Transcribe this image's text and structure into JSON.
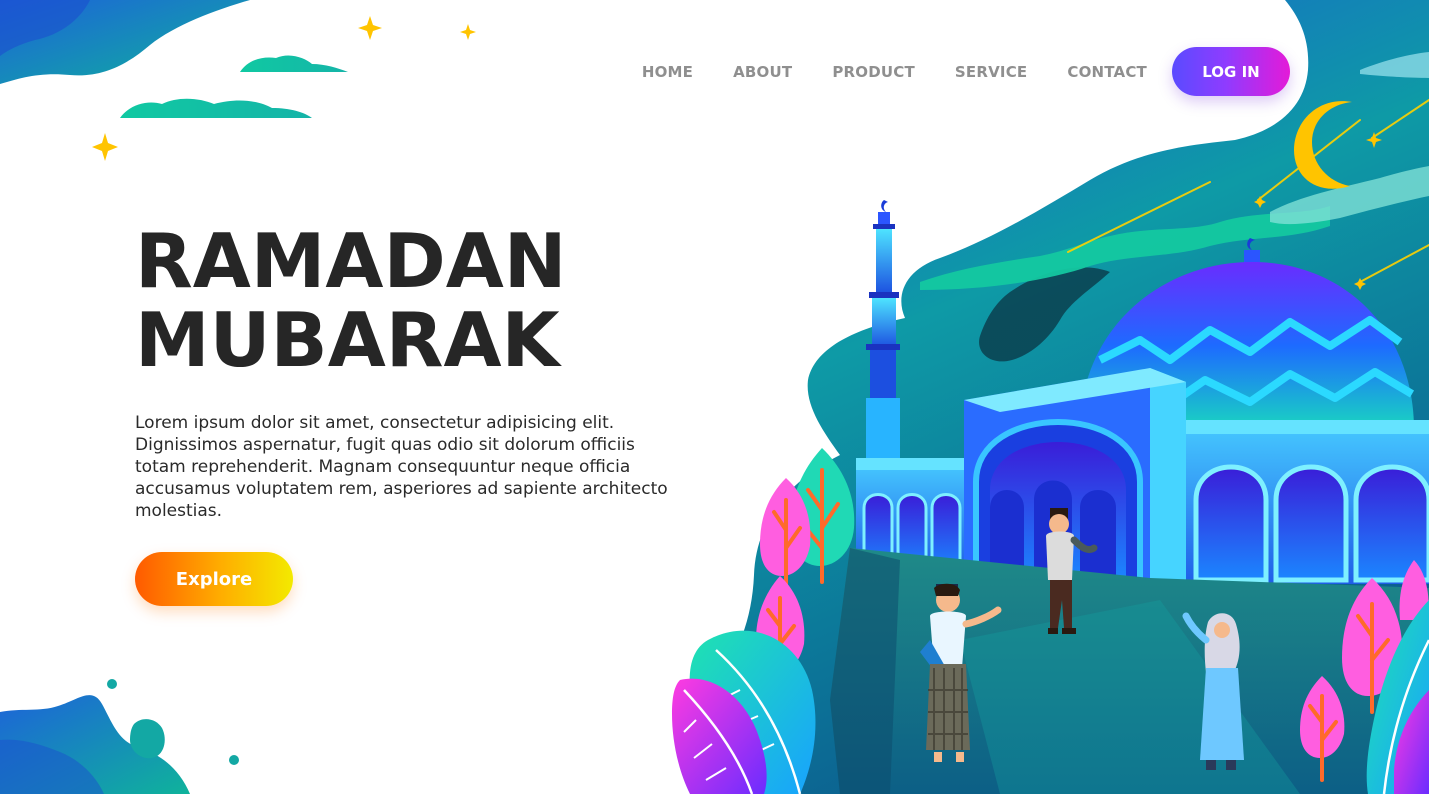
{
  "nav": {
    "items": [
      {
        "label": "HOME"
      },
      {
        "label": "ABOUT"
      },
      {
        "label": "PRODUCT"
      },
      {
        "label": "SERVICE"
      },
      {
        "label": "CONTACT"
      }
    ],
    "login_label": "LOG IN"
  },
  "hero": {
    "title_line1": "RAMADAN",
    "title_line2": "MUBARAK",
    "text": "Lorem ipsum dolor sit amet, consectetur adipisicing elit. Dignissimos aspernatur, fugit quas odio sit dolorum officiis totam reprehenderit. Magnam consequuntur neque officia accusamus voluptatem rem, asperiores ad sapiente architecto molestias.",
    "explore_label": "Explore"
  },
  "illustration": {
    "icons": [
      "star-icon",
      "crescent-moon-icon",
      "cloud-icon",
      "mosque-icon",
      "minaret-icon",
      "tree-icon",
      "leaf-icon",
      "person-icon"
    ]
  },
  "colors": {
    "teal": "#0fb3a0",
    "deep_blue": "#1a5fd8",
    "purple": "#8a2be2",
    "magenta": "#e41ad8",
    "star_yellow": "#ffc400",
    "title": "#262626",
    "nav_text": "#8f8f8f",
    "login_gradient_start": "#5a4bff",
    "login_gradient_end": "#e41ad8",
    "explore_gradient_start": "#ff5a00",
    "explore_gradient_end": "#f3ea00"
  }
}
